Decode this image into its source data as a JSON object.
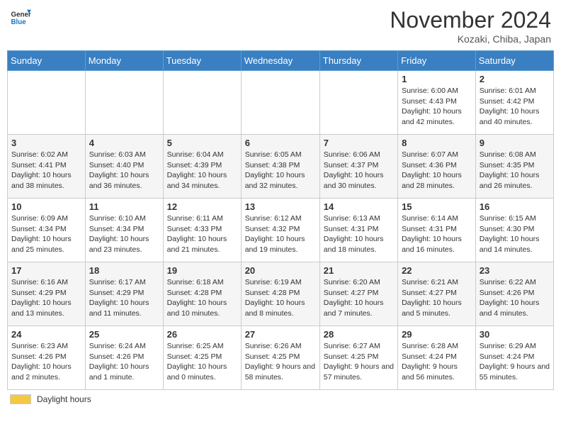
{
  "logo": {
    "line1": "General",
    "line2": "Blue"
  },
  "header": {
    "title": "November 2024",
    "subtitle": "Kozaki, Chiba, Japan"
  },
  "days_of_week": [
    "Sunday",
    "Monday",
    "Tuesday",
    "Wednesday",
    "Thursday",
    "Friday",
    "Saturday"
  ],
  "footer": {
    "label": "Daylight hours"
  },
  "weeks": [
    [
      {
        "day": "",
        "info": ""
      },
      {
        "day": "",
        "info": ""
      },
      {
        "day": "",
        "info": ""
      },
      {
        "day": "",
        "info": ""
      },
      {
        "day": "",
        "info": ""
      },
      {
        "day": "1",
        "info": "Sunrise: 6:00 AM\nSunset: 4:43 PM\nDaylight: 10 hours and 42 minutes."
      },
      {
        "day": "2",
        "info": "Sunrise: 6:01 AM\nSunset: 4:42 PM\nDaylight: 10 hours and 40 minutes."
      }
    ],
    [
      {
        "day": "3",
        "info": "Sunrise: 6:02 AM\nSunset: 4:41 PM\nDaylight: 10 hours and 38 minutes."
      },
      {
        "day": "4",
        "info": "Sunrise: 6:03 AM\nSunset: 4:40 PM\nDaylight: 10 hours and 36 minutes."
      },
      {
        "day": "5",
        "info": "Sunrise: 6:04 AM\nSunset: 4:39 PM\nDaylight: 10 hours and 34 minutes."
      },
      {
        "day": "6",
        "info": "Sunrise: 6:05 AM\nSunset: 4:38 PM\nDaylight: 10 hours and 32 minutes."
      },
      {
        "day": "7",
        "info": "Sunrise: 6:06 AM\nSunset: 4:37 PM\nDaylight: 10 hours and 30 minutes."
      },
      {
        "day": "8",
        "info": "Sunrise: 6:07 AM\nSunset: 4:36 PM\nDaylight: 10 hours and 28 minutes."
      },
      {
        "day": "9",
        "info": "Sunrise: 6:08 AM\nSunset: 4:35 PM\nDaylight: 10 hours and 26 minutes."
      }
    ],
    [
      {
        "day": "10",
        "info": "Sunrise: 6:09 AM\nSunset: 4:34 PM\nDaylight: 10 hours and 25 minutes."
      },
      {
        "day": "11",
        "info": "Sunrise: 6:10 AM\nSunset: 4:34 PM\nDaylight: 10 hours and 23 minutes."
      },
      {
        "day": "12",
        "info": "Sunrise: 6:11 AM\nSunset: 4:33 PM\nDaylight: 10 hours and 21 minutes."
      },
      {
        "day": "13",
        "info": "Sunrise: 6:12 AM\nSunset: 4:32 PM\nDaylight: 10 hours and 19 minutes."
      },
      {
        "day": "14",
        "info": "Sunrise: 6:13 AM\nSunset: 4:31 PM\nDaylight: 10 hours and 18 minutes."
      },
      {
        "day": "15",
        "info": "Sunrise: 6:14 AM\nSunset: 4:31 PM\nDaylight: 10 hours and 16 minutes."
      },
      {
        "day": "16",
        "info": "Sunrise: 6:15 AM\nSunset: 4:30 PM\nDaylight: 10 hours and 14 minutes."
      }
    ],
    [
      {
        "day": "17",
        "info": "Sunrise: 6:16 AM\nSunset: 4:29 PM\nDaylight: 10 hours and 13 minutes."
      },
      {
        "day": "18",
        "info": "Sunrise: 6:17 AM\nSunset: 4:29 PM\nDaylight: 10 hours and 11 minutes."
      },
      {
        "day": "19",
        "info": "Sunrise: 6:18 AM\nSunset: 4:28 PM\nDaylight: 10 hours and 10 minutes."
      },
      {
        "day": "20",
        "info": "Sunrise: 6:19 AM\nSunset: 4:28 PM\nDaylight: 10 hours and 8 minutes."
      },
      {
        "day": "21",
        "info": "Sunrise: 6:20 AM\nSunset: 4:27 PM\nDaylight: 10 hours and 7 minutes."
      },
      {
        "day": "22",
        "info": "Sunrise: 6:21 AM\nSunset: 4:27 PM\nDaylight: 10 hours and 5 minutes."
      },
      {
        "day": "23",
        "info": "Sunrise: 6:22 AM\nSunset: 4:26 PM\nDaylight: 10 hours and 4 minutes."
      }
    ],
    [
      {
        "day": "24",
        "info": "Sunrise: 6:23 AM\nSunset: 4:26 PM\nDaylight: 10 hours and 2 minutes."
      },
      {
        "day": "25",
        "info": "Sunrise: 6:24 AM\nSunset: 4:26 PM\nDaylight: 10 hours and 1 minute."
      },
      {
        "day": "26",
        "info": "Sunrise: 6:25 AM\nSunset: 4:25 PM\nDaylight: 10 hours and 0 minutes."
      },
      {
        "day": "27",
        "info": "Sunrise: 6:26 AM\nSunset: 4:25 PM\nDaylight: 9 hours and 58 minutes."
      },
      {
        "day": "28",
        "info": "Sunrise: 6:27 AM\nSunset: 4:25 PM\nDaylight: 9 hours and 57 minutes."
      },
      {
        "day": "29",
        "info": "Sunrise: 6:28 AM\nSunset: 4:24 PM\nDaylight: 9 hours and 56 minutes."
      },
      {
        "day": "30",
        "info": "Sunrise: 6:29 AM\nSunset: 4:24 PM\nDaylight: 9 hours and 55 minutes."
      }
    ]
  ]
}
